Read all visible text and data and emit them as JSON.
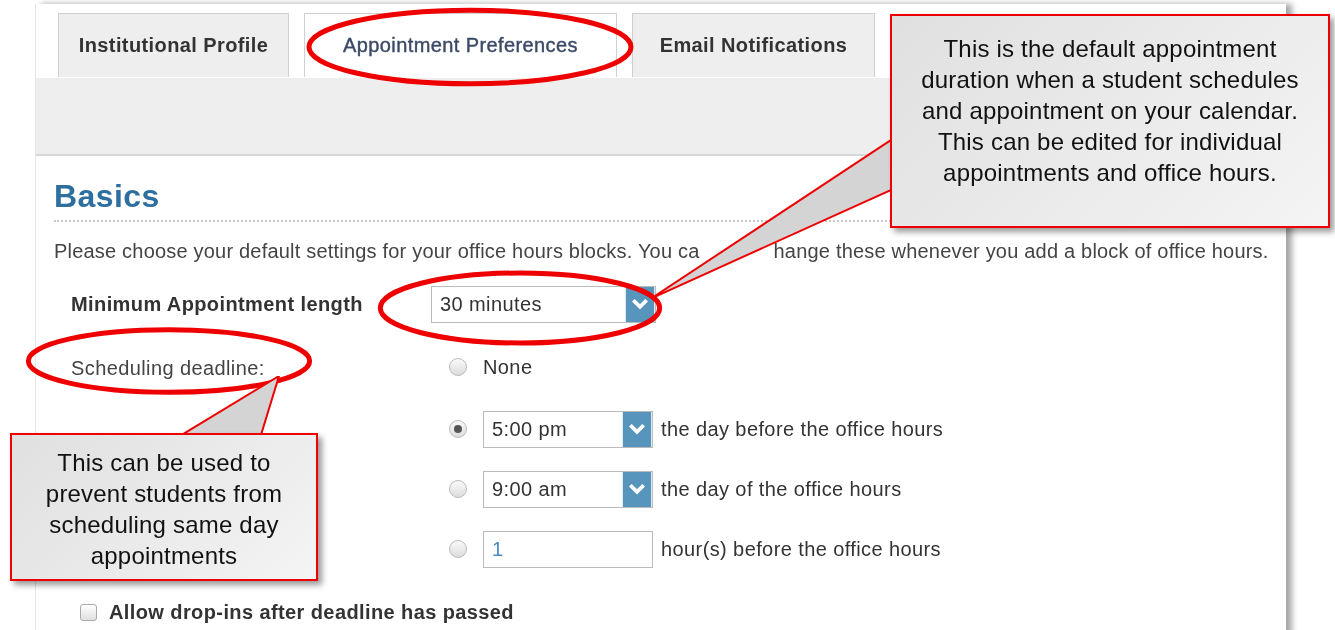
{
  "tabs": [
    {
      "label": "Institutional Profile",
      "selected": false
    },
    {
      "label": "Appointment Preferences",
      "selected": true
    },
    {
      "label": "Email Notifications",
      "selected": false
    }
  ],
  "section": {
    "heading": "Basics",
    "intro": [
      "Please choose your default settings for your office hours blocks. You ca",
      "hange these whenever you add a block of office hours."
    ],
    "min_length": {
      "label": "Minimum Appointment length",
      "value": "30 minutes"
    },
    "deadline": {
      "label": "Scheduling deadline:",
      "options": [
        {
          "kind": "plain",
          "selected": false,
          "text": "None"
        },
        {
          "kind": "select",
          "selected": true,
          "value": "5:00 pm",
          "text": "the day before the office hours"
        },
        {
          "kind": "select",
          "selected": false,
          "value": "9:00 am",
          "text": "the day of the office hours"
        },
        {
          "kind": "number",
          "selected": false,
          "value": "1",
          "text": "hour(s) before the office hours"
        }
      ]
    },
    "drop_ins": {
      "label": "Allow drop-ins after deadline has passed",
      "checked": false
    }
  },
  "callouts": [
    {
      "kind": "right",
      "text": "This is the default appointment duration when a student schedules and appointment on your calendar. This can be edited for individual appointments and office hours."
    },
    {
      "kind": "left",
      "text": "This can be used to prevent students from scheduling same day appointments"
    }
  ]
}
